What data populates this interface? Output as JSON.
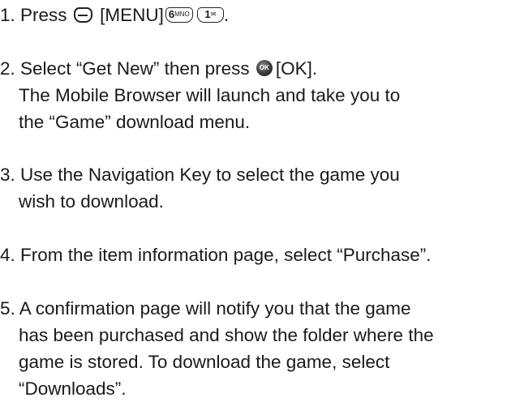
{
  "steps": [
    {
      "number": "1.",
      "before": "Press",
      "softkey_label": "[MENU]",
      "key_6": {
        "digit": "6",
        "letters": "MNO"
      },
      "key_1": {
        "digit": "1",
        "letters": "✉"
      },
      "after": "."
    },
    {
      "number": "2.",
      "before": "Select “Get New” then press",
      "ok_icon_text": "OK",
      "after": "[OK].",
      "lines": [
        "The Mobile Browser will launch and take you to",
        "the “Game” download menu."
      ]
    },
    {
      "number": "3.",
      "lines": [
        "Use the Navigation Key to select the game you",
        "wish to download."
      ]
    },
    {
      "number": "4.",
      "lines": [
        "From the item information page, select “Purchase”."
      ]
    },
    {
      "number": "5.",
      "lines": [
        "A confirmation page will notify you that the game",
        "has been purchased and show the folder where the",
        "game is stored. To download the game, select",
        "“Downloads”."
      ]
    }
  ]
}
